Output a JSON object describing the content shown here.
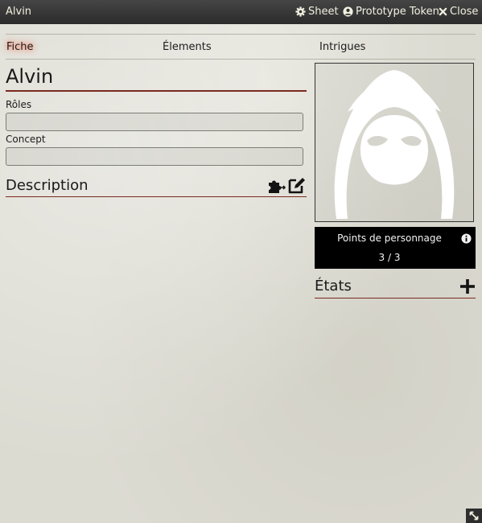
{
  "window": {
    "title": "Alvin",
    "buttons": [
      {
        "icon": "gear-icon",
        "label": "Sheet"
      },
      {
        "icon": "user-circle-icon",
        "label": "Prototype Token"
      },
      {
        "icon": "close-icon",
        "label": "Close"
      }
    ]
  },
  "tabs": [
    {
      "label": "Fiche",
      "active": true
    },
    {
      "label": "Élements",
      "active": false
    },
    {
      "label": "Intrigues",
      "active": false
    }
  ],
  "character": {
    "name": "Alvin",
    "roles": {
      "label": "Rôles",
      "value": ""
    },
    "concept": {
      "label": "Concept",
      "value": ""
    }
  },
  "description": {
    "title": "Description",
    "icons": [
      "puzzle-icon",
      "edit-icon"
    ]
  },
  "portrait": {
    "icon": "hooded-figure-icon"
  },
  "points": {
    "label": "Points de personnage",
    "value": "3 / 3",
    "icon": "info-icon"
  },
  "states": {
    "title": "États",
    "icon": "plus-icon"
  },
  "colors": {
    "title_bar": "#2b2b2b",
    "accent_rule": "#7a2a20",
    "active_tab_glow": "#ff6a4a",
    "parchment": "#dcdbd2"
  }
}
